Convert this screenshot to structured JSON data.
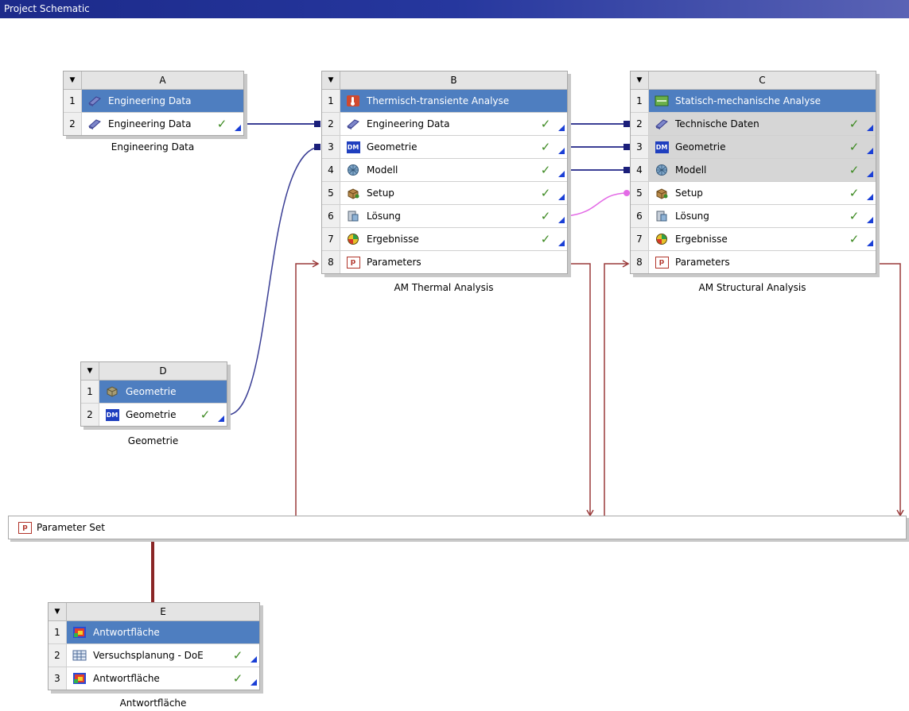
{
  "window": {
    "title": "Project Schematic"
  },
  "systems": {
    "A": {
      "letter": "A",
      "caption": "Engineering Data",
      "rows": [
        {
          "num": "1",
          "label": "Engineering Data",
          "icon": "engineering-data-icon"
        },
        {
          "num": "2",
          "label": "Engineering Data",
          "icon": "engineering-data-icon",
          "status": "✓"
        }
      ]
    },
    "B": {
      "letter": "B",
      "caption": "AM Thermal Analysis",
      "rows": [
        {
          "num": "1",
          "label": "Thermisch-transiente Analyse",
          "icon": "thermal-analysis-icon"
        },
        {
          "num": "2",
          "label": "Engineering Data",
          "icon": "engineering-data-icon",
          "status": "✓"
        },
        {
          "num": "3",
          "label": "Geometrie",
          "icon": "designmodeler-icon",
          "status": "✓"
        },
        {
          "num": "4",
          "label": "Modell",
          "icon": "model-icon",
          "status": "✓"
        },
        {
          "num": "5",
          "label": "Setup",
          "icon": "setup-icon",
          "status": "✓"
        },
        {
          "num": "6",
          "label": "Lösung",
          "icon": "solution-icon",
          "status": "✓"
        },
        {
          "num": "7",
          "label": "Ergebnisse",
          "icon": "results-icon",
          "status": "✓"
        },
        {
          "num": "8",
          "label": "Parameters",
          "icon": "parameters-icon"
        }
      ]
    },
    "C": {
      "letter": "C",
      "caption": "AM Structural Analysis",
      "rows": [
        {
          "num": "1",
          "label": "Statisch-mechanische Analyse",
          "icon": "static-structural-icon"
        },
        {
          "num": "2",
          "label": "Technische Daten",
          "icon": "engineering-data-icon",
          "status": "✓"
        },
        {
          "num": "3",
          "label": "Geometrie",
          "icon": "designmodeler-icon",
          "status": "✓"
        },
        {
          "num": "4",
          "label": "Modell",
          "icon": "model-icon",
          "status": "✓"
        },
        {
          "num": "5",
          "label": "Setup",
          "icon": "setup-icon",
          "status": "✓"
        },
        {
          "num": "6",
          "label": "Lösung",
          "icon": "solution-icon",
          "status": "✓"
        },
        {
          "num": "7",
          "label": "Ergebnisse",
          "icon": "results-icon",
          "status": "✓"
        },
        {
          "num": "8",
          "label": "Parameters",
          "icon": "parameters-icon"
        }
      ]
    },
    "D": {
      "letter": "D",
      "caption": "Geometrie",
      "rows": [
        {
          "num": "1",
          "label": "Geometrie",
          "icon": "geometry-box-icon"
        },
        {
          "num": "2",
          "label": "Geometrie",
          "icon": "designmodeler-icon",
          "status": "✓"
        }
      ]
    },
    "E": {
      "letter": "E",
      "caption": "Antwortfläche",
      "rows": [
        {
          "num": "1",
          "label": "Antwortfläche",
          "icon": "response-surface-icon"
        },
        {
          "num": "2",
          "label": "Versuchsplanung - DoE",
          "icon": "doe-table-icon",
          "status": "✓"
        },
        {
          "num": "3",
          "label": "Antwortfläche",
          "icon": "response-surface-icon",
          "status": "✓"
        }
      ]
    }
  },
  "parameter_set": {
    "label": "Parameter Set",
    "icon": "parameters-icon"
  },
  "dm_text": "DM",
  "p_text": "p",
  "colors": {
    "title_row": "#4e7ec0",
    "data_link": "#3b3f95",
    "param_link": "#9a3a3a",
    "pink_link": "#e36ae6",
    "check": "#3d8a22"
  }
}
